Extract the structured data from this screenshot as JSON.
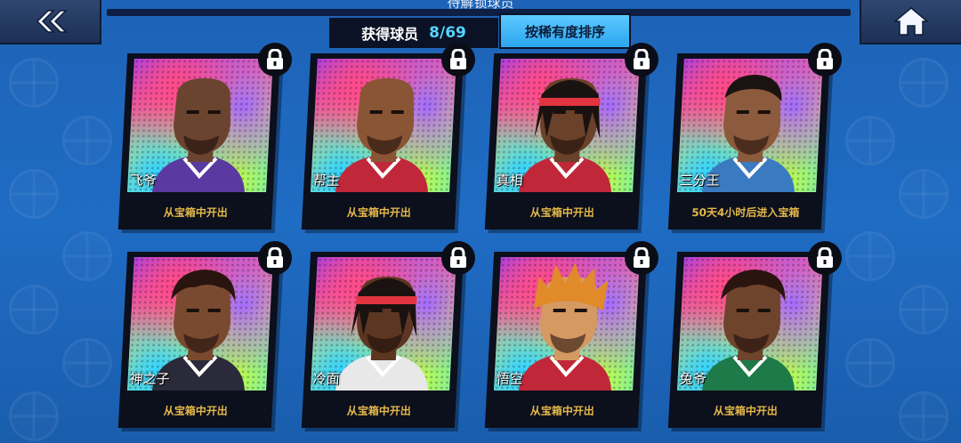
{
  "header": {
    "title": "待解锁球员",
    "collected_label": "获得球员",
    "collected_value": "8/69",
    "sort_label": "按稀有度排序"
  },
  "navigation": {
    "back_icon": "double-chevron-left-icon",
    "home_icon": "home-icon"
  },
  "players": [
    {
      "name": "飞爷",
      "unlock": "从宝箱中开出",
      "hair": "bald",
      "skin": "#6b4430",
      "jersey": "#5a3aa0"
    },
    {
      "name": "帮主",
      "unlock": "从宝箱中开出",
      "hair": "bald",
      "skin": "#8a5535",
      "jersey": "#c0283a"
    },
    {
      "name": "真相",
      "unlock": "从宝箱中开出",
      "hair": "braids",
      "skin": "#6a4129",
      "jersey": "#c0283a"
    },
    {
      "name": "三分王",
      "unlock": "50天4小时后进入宝箱",
      "hair": "short",
      "skin": "#8c5a3c",
      "jersey": "#3a7ac0"
    },
    {
      "name": "神之子",
      "unlock": "从宝箱中开出",
      "hair": "curly",
      "skin": "#7a4a30",
      "jersey": "#2a2a3a"
    },
    {
      "name": "冷面",
      "unlock": "从宝箱中开出",
      "hair": "braids",
      "skin": "#5d3622",
      "jersey": "#e8e8e8"
    },
    {
      "name": "悟空",
      "unlock": "从宝箱中开出",
      "hair": "spiky",
      "skin": "#d59a62",
      "jersey": "#c0283a"
    },
    {
      "name": "兔爷",
      "unlock": "从宝箱中开出",
      "hair": "curly",
      "skin": "#6f442c",
      "jersey": "#1f7a4a"
    }
  ]
}
